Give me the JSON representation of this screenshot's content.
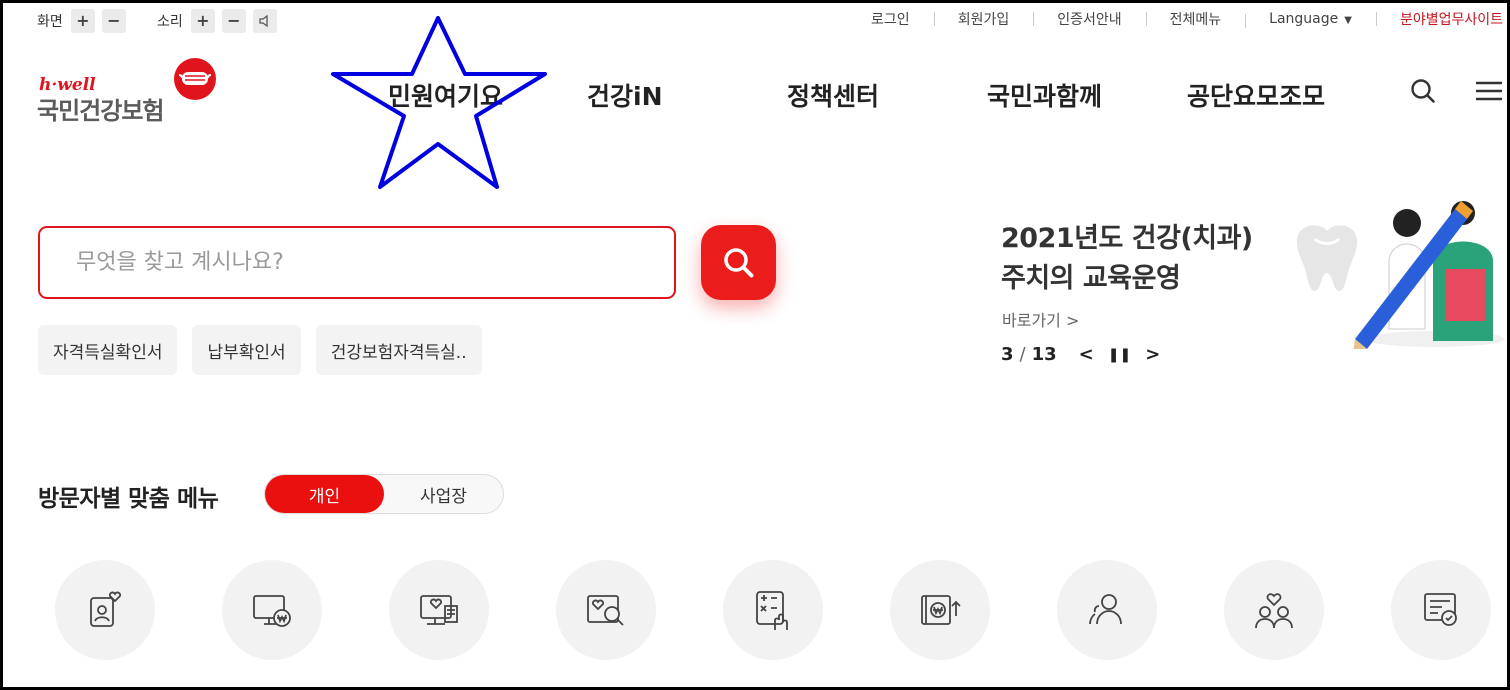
{
  "utility": {
    "screen_label": "화면",
    "sound_label": "소리",
    "plus": "+",
    "minus": "−",
    "links": [
      "로그인",
      "회원가입",
      "인증서안내",
      "전체메뉴"
    ],
    "language": "Language",
    "language_caret": "▼",
    "business_site": "분야별업무사이트"
  },
  "logo": {
    "tagline": "h·well",
    "name": "국민건강보험"
  },
  "nav": [
    "민원여기요",
    "건강iN",
    "정책센터",
    "국민과함께",
    "공단요모조모"
  ],
  "search": {
    "placeholder": "무엇을 찾고 계시나요?",
    "value": ""
  },
  "quick_tags": [
    "자격득실확인서",
    "납부확인서",
    "건강보험자격득실.."
  ],
  "banner": {
    "title_line1": "2021년도 건강(치과)",
    "title_line2": "주치의 교육운영",
    "link": "바로가기 >",
    "current": "3",
    "separator": "/",
    "total": "13",
    "prev": "<",
    "pause": "❚❚",
    "next": ">"
  },
  "visitor_menu": {
    "title": "방문자별 맞춤 메뉴",
    "options": [
      "개인",
      "사업장"
    ],
    "selected": "개인"
  },
  "menu_icons": [
    "profile-heart-icon",
    "monitor-won-icon",
    "monitor-certificate-icon",
    "heart-search-icon",
    "calculator-hand-icon",
    "wallet-won-up-icon",
    "users-icon",
    "family-heart-icon",
    "document-check-icon"
  ],
  "colors": {
    "brand_red": "#e0141d",
    "button_red": "#ea1c1c",
    "star_blue": "#0000e0"
  }
}
